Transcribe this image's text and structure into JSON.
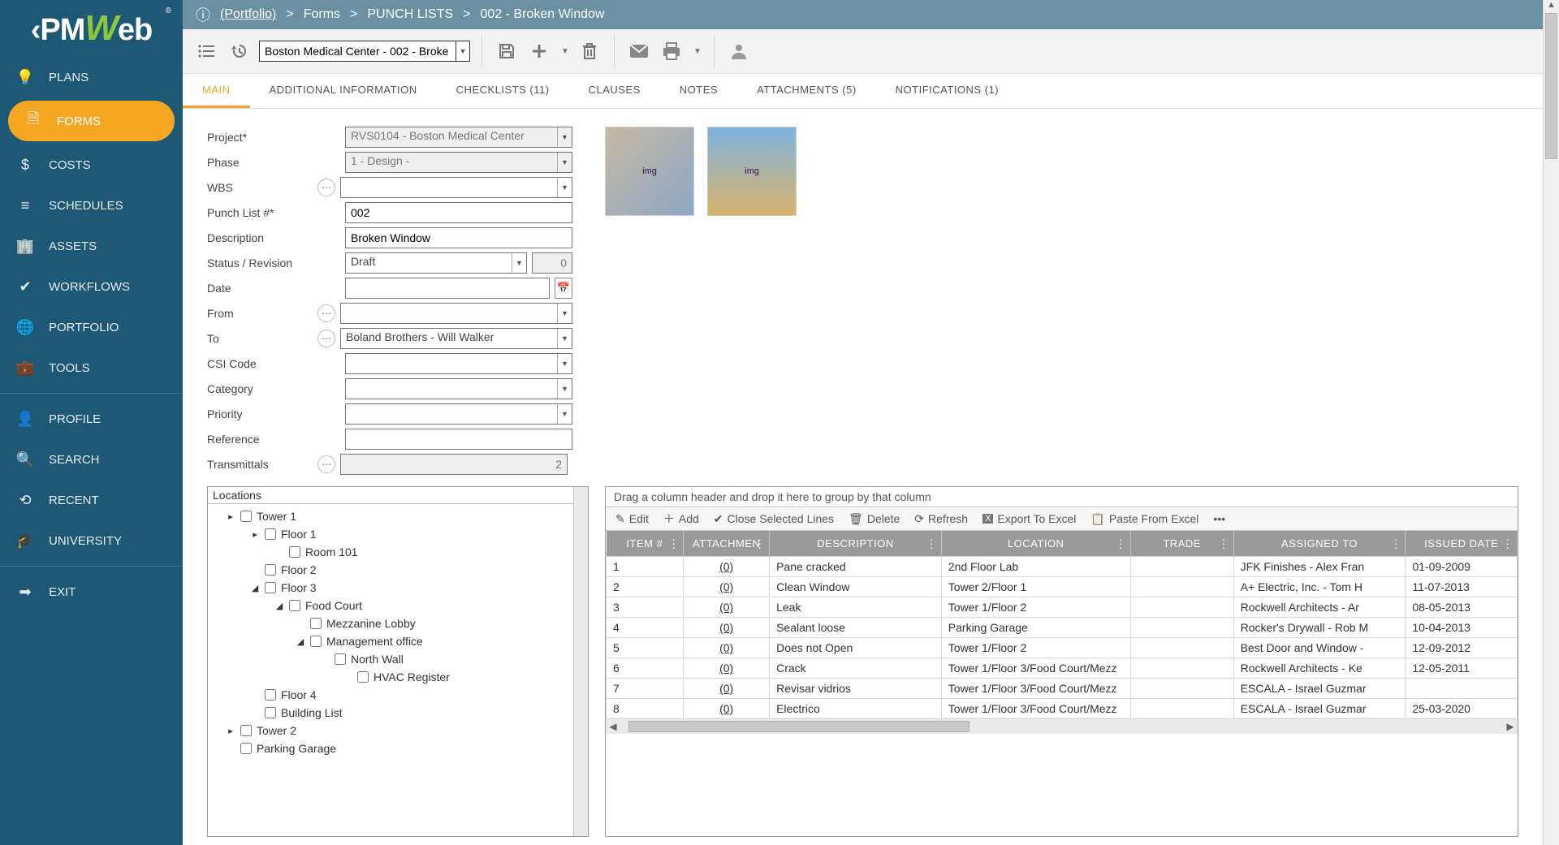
{
  "brand": {
    "name": "PMWeb"
  },
  "sidebar": {
    "items": [
      {
        "label": "PLANS",
        "icon": "bulb-icon"
      },
      {
        "label": "FORMS",
        "icon": "forms-icon",
        "active": true
      },
      {
        "label": "COSTS",
        "icon": "dollar-icon"
      },
      {
        "label": "SCHEDULES",
        "icon": "schedules-icon"
      },
      {
        "label": "ASSETS",
        "icon": "assets-icon"
      },
      {
        "label": "WORKFLOWS",
        "icon": "check-icon"
      },
      {
        "label": "PORTFOLIO",
        "icon": "globe-icon"
      },
      {
        "label": "TOOLS",
        "icon": "tools-icon"
      }
    ],
    "items2": [
      {
        "label": "PROFILE",
        "icon": "profile-icon"
      },
      {
        "label": "SEARCH",
        "icon": "search-icon"
      },
      {
        "label": "RECENT",
        "icon": "recent-icon"
      },
      {
        "label": "UNIVERSITY",
        "icon": "university-icon"
      }
    ],
    "items3": [
      {
        "label": "EXIT",
        "icon": "exit-icon"
      }
    ]
  },
  "breadcrumb": {
    "portfolio": "(Portfolio)",
    "part1": "Forms",
    "part2": "PUNCH LISTS",
    "part3": "002 - Broken Window"
  },
  "toolbar": {
    "record_selector": "Boston Medical Center - 002 - Broke"
  },
  "tabs": [
    {
      "label": "MAIN",
      "active": true
    },
    {
      "label": "ADDITIONAL INFORMATION"
    },
    {
      "label": "CHECKLISTS (11)"
    },
    {
      "label": "CLAUSES"
    },
    {
      "label": "NOTES"
    },
    {
      "label": "ATTACHMENTS (5)"
    },
    {
      "label": "NOTIFICATIONS (1)"
    }
  ],
  "form": {
    "labels": {
      "project": "Project*",
      "phase": "Phase",
      "wbs": "WBS",
      "punchlist_no": "Punch List #*",
      "description": "Description",
      "status_rev": "Status / Revision",
      "date": "Date",
      "from": "From",
      "to": "To",
      "csi": "CSI Code",
      "category": "Category",
      "priority": "Priority",
      "reference": "Reference",
      "transmittals": "Transmittals"
    },
    "values": {
      "project": "RVS0104 - Boston Medical Center",
      "phase": "1 - Design -",
      "wbs": "",
      "punchlist_no": "002",
      "description": "Broken Window",
      "status": "Draft",
      "revision": "0",
      "date": "",
      "from": "",
      "to": "Boland Brothers - Will Walker",
      "csi": "",
      "category": "",
      "priority": "",
      "reference": "",
      "transmittals": "2"
    }
  },
  "locations": {
    "title": "Locations",
    "tree": [
      {
        "level": 1,
        "twist": "▸",
        "label": "Tower 1"
      },
      {
        "level": 2,
        "twist": "▸",
        "label": "Floor 1"
      },
      {
        "level": 3,
        "twist": "",
        "label": "Room 101"
      },
      {
        "level": 2,
        "twist": "",
        "label": "Floor 2"
      },
      {
        "level": 2,
        "twist": "◢",
        "label": "Floor 3"
      },
      {
        "level": 3,
        "twist": "◢",
        "label": "Food Court"
      },
      {
        "level": 4,
        "twist": "",
        "label": "Mezzanine Lobby"
      },
      {
        "level": 4,
        "twist": "◢",
        "label": "Management office"
      },
      {
        "level": 5,
        "twist": "",
        "label": "North Wall"
      },
      {
        "level": 6,
        "twist": "",
        "label": "HVAC Register"
      },
      {
        "level": 2,
        "twist": "",
        "label": "Floor 4"
      },
      {
        "level": 2,
        "twist": "",
        "label": "Building List"
      },
      {
        "level": 1,
        "twist": "▸",
        "label": "Tower 2"
      },
      {
        "level": 1,
        "twist": "",
        "label": "Parking Garage"
      }
    ]
  },
  "grid": {
    "group_hint": "Drag a column header and drop it here to group by that column",
    "tools": {
      "edit": "Edit",
      "add": "Add",
      "close": "Close Selected Lines",
      "delete": "Delete",
      "refresh": "Refresh",
      "export": "Export To Excel",
      "paste": "Paste From Excel"
    },
    "columns": [
      "ITEM #",
      "ATTACHMEN",
      "DESCRIPTION",
      "LOCATION",
      "TRADE",
      "ASSIGNED TO",
      "ISSUED DATE"
    ],
    "rows": [
      {
        "item": "1",
        "att": "(0)",
        "desc": "Pane cracked",
        "loc": "2nd Floor Lab",
        "trade": "",
        "assigned": "JFK Finishes - Alex Fran",
        "issued": "01-09-2009"
      },
      {
        "item": "2",
        "att": "(0)",
        "desc": "Clean Window",
        "loc": "Tower 2/Floor 1",
        "trade": "",
        "assigned": "A+ Electric, Inc. - Tom H",
        "issued": "11-07-2013"
      },
      {
        "item": "3",
        "att": "(0)",
        "desc": "Leak",
        "loc": "Tower 1/Floor 2",
        "trade": "",
        "assigned": "Rockwell Architects - Ar",
        "issued": "08-05-2013"
      },
      {
        "item": "4",
        "att": "(0)",
        "desc": "Sealant loose",
        "loc": "Parking Garage",
        "trade": "",
        "assigned": "Rocker's Drywall - Rob M",
        "issued": "10-04-2013"
      },
      {
        "item": "5",
        "att": "(0)",
        "desc": "Does not Open",
        "loc": "Tower 1/Floor 2",
        "trade": "",
        "assigned": "Best Door and Window -",
        "issued": "12-09-2012"
      },
      {
        "item": "6",
        "att": "(0)",
        "desc": "Crack",
        "loc": "Tower 1/Floor 3/Food Court/Mezz",
        "trade": "",
        "assigned": "Rockwell Architects - Ke",
        "issued": "12-05-2011"
      },
      {
        "item": "7",
        "att": "(0)",
        "desc": "Revisar vidrios",
        "loc": "Tower 1/Floor 3/Food Court/Mezz",
        "trade": "",
        "assigned": "ESCALA - Israel Guzmar",
        "issued": ""
      },
      {
        "item": "8",
        "att": "(0)",
        "desc": "Electrico",
        "loc": "Tower 1/Floor 3/Food Court/Mezz",
        "trade": "",
        "assigned": "ESCALA - Israel Guzmar",
        "issued": "25-03-2020"
      }
    ]
  }
}
